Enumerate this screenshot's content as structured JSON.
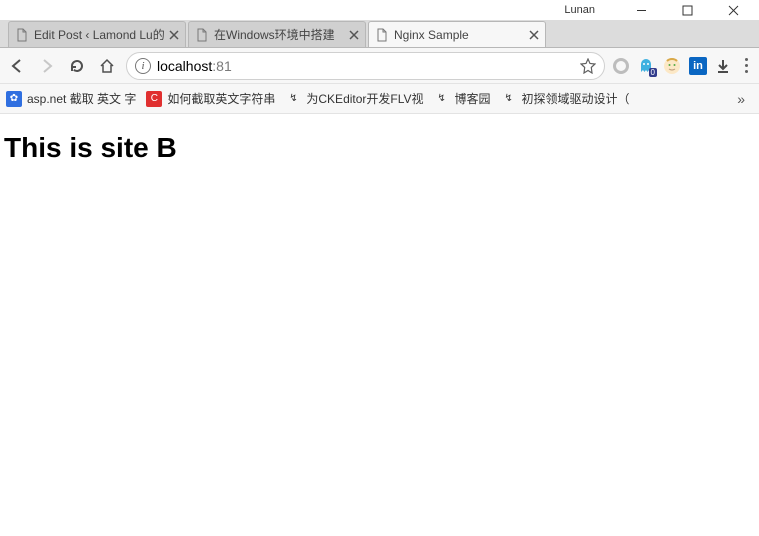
{
  "window": {
    "profile": "Lunan"
  },
  "tabs": [
    {
      "title": "Edit Post ‹ Lamond Lu的",
      "active": false
    },
    {
      "title": "在Windows环境中搭建",
      "active": false
    },
    {
      "title": "Nginx Sample",
      "active": true
    }
  ],
  "address": {
    "host": "localhost",
    "port": ":81"
  },
  "bookmarks": [
    {
      "label": "asp.net 截取 英文 字",
      "icon_bg": "#2f6fe0",
      "glyph": "✿"
    },
    {
      "label": "如何截取英文字符串",
      "icon_bg": "#e03030",
      "glyph": "C"
    },
    {
      "label": "为CKEditor开发FLV视",
      "icon_bg": "transparent",
      "glyph": "↯"
    },
    {
      "label": "博客园",
      "icon_bg": "transparent",
      "glyph": "↯"
    },
    {
      "label": "初探领域驱动设计（",
      "icon_bg": "transparent",
      "glyph": "↯"
    }
  ],
  "extensions": {
    "ghost_badge": "0",
    "linkedin": "in"
  },
  "page": {
    "heading": "This is site B"
  }
}
